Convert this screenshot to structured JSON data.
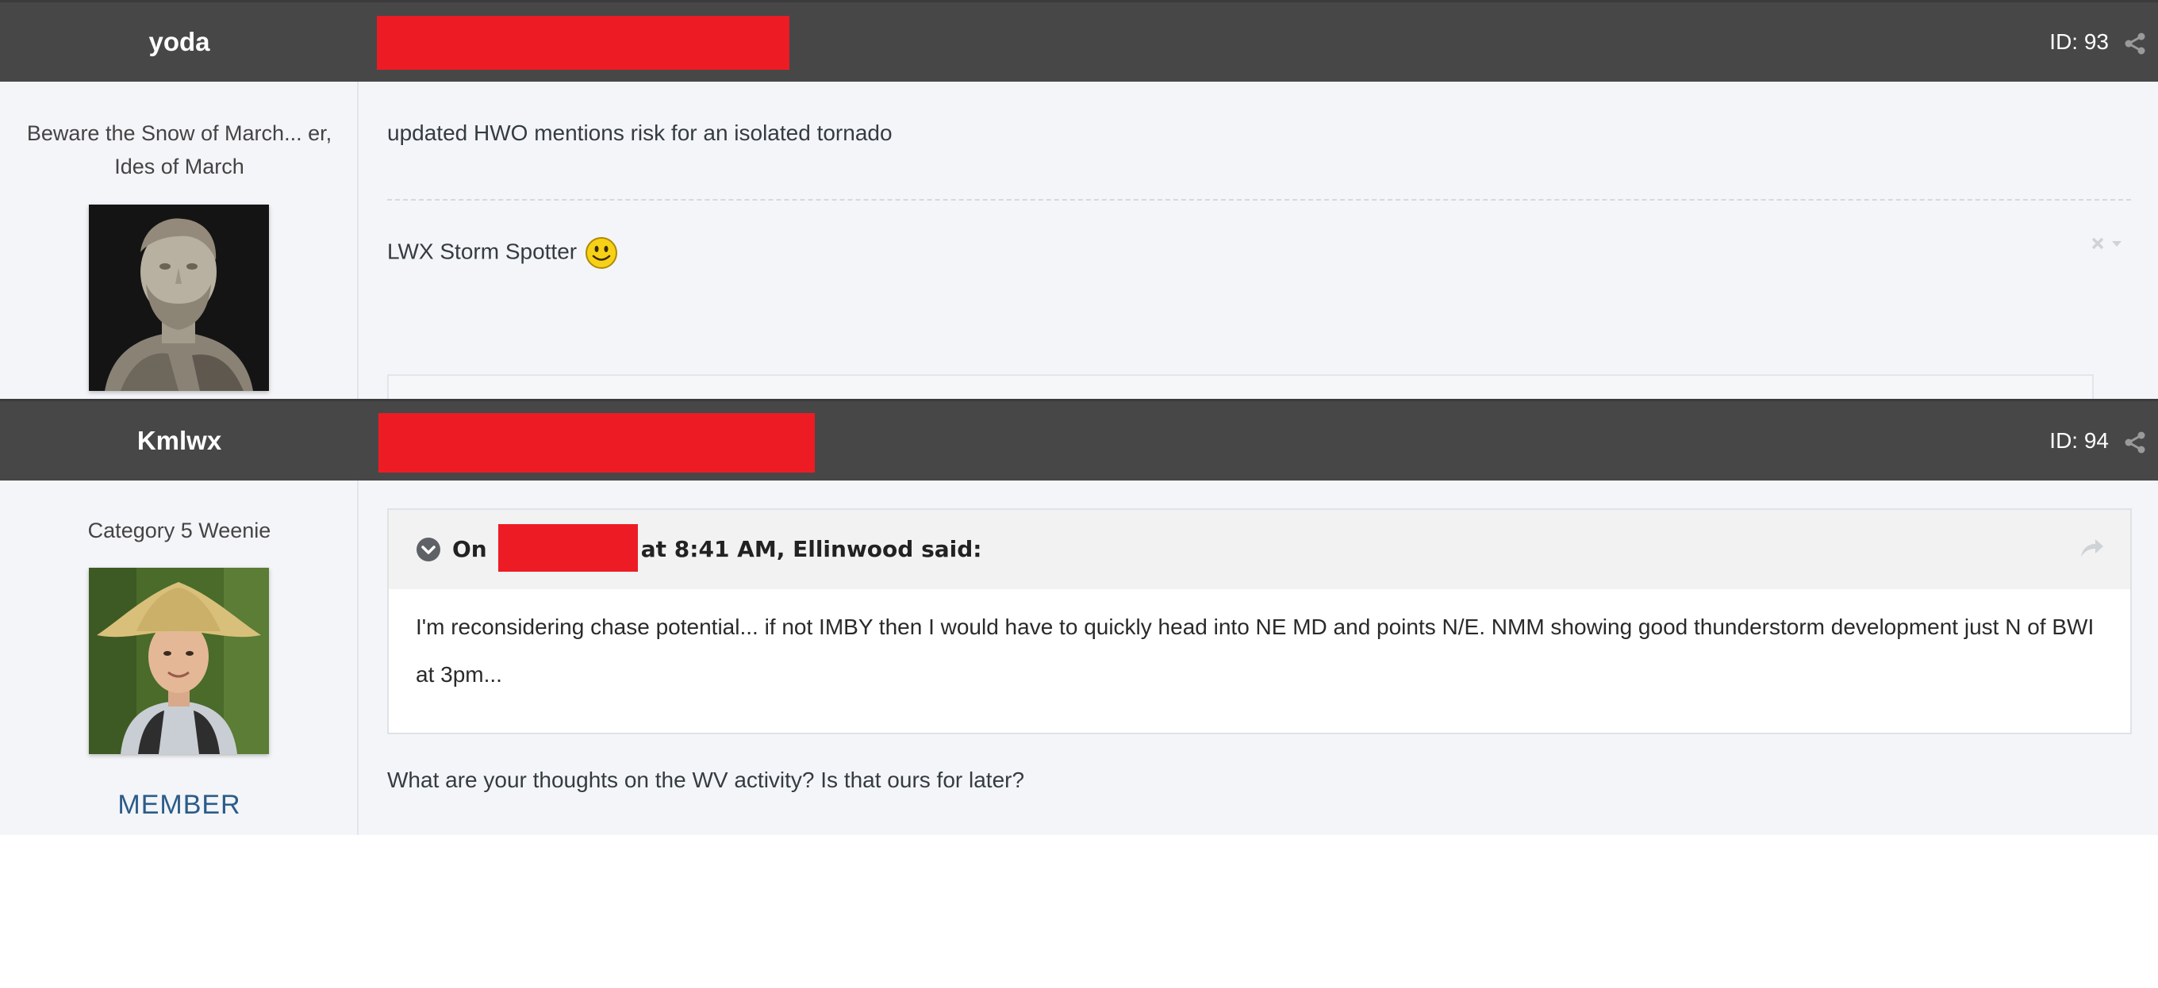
{
  "posts": [
    {
      "author": "yoda",
      "post_id": "ID: 93",
      "user_title": "Beware the Snow of March... er, Ides of March",
      "avatar_icon": "marble-bust-avatar",
      "content": "updated HWO mentions risk for an isolated tornado",
      "signature": "LWX Storm Spotter",
      "signature_emoji_icon": "smiley-icon"
    },
    {
      "author": "Kmlwx",
      "post_id": "ID: 94",
      "user_title": "Category 5 Weenie",
      "avatar_icon": "person-straw-hat-avatar",
      "group": "MEMBER",
      "quote": {
        "cite_prefix": "On",
        "cite_suffix": "at 8:41 AM, Ellinwood said:",
        "text": "I'm reconsidering chase potential... if not IMBY then I would have to quickly head into NE MD and points N/E. NMM showing good thunderstorm development just N of BWI at 3pm..."
      },
      "content": "What are your thoughts on the WV activity? Is that ours for later?"
    }
  ],
  "colors": {
    "header_bg": "#474747",
    "redaction": "#ed1c24",
    "post_bg": "#f4f5f8",
    "group_color": "#2b5c8a"
  }
}
